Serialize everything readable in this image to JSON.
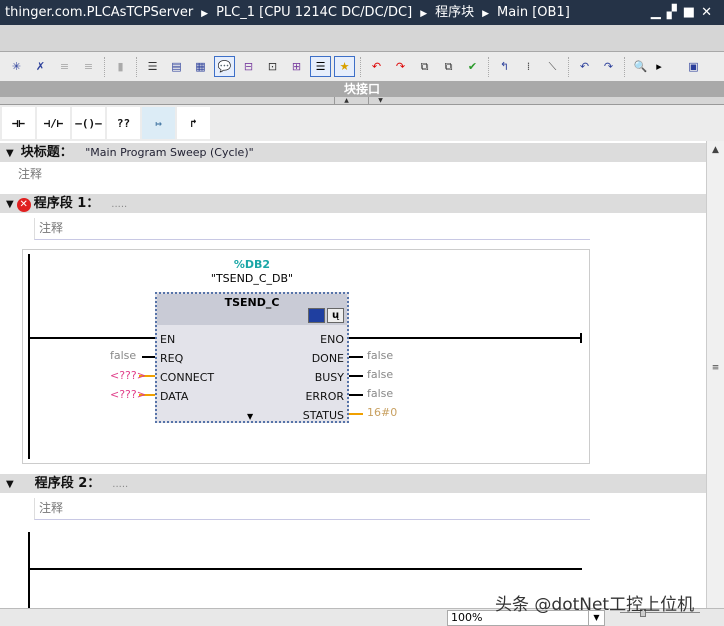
{
  "breadcrumb": [
    "thinger.com.PLCAsTCPServer",
    "PLC_1 [CPU 1214C DC/DC/DC]",
    "程序块",
    "Main [OB1]"
  ],
  "window_controls": {
    "minimize": "▁",
    "restore": "▞",
    "maximize": "■",
    "close": "✕"
  },
  "toolbar": {
    "icons": [
      "insert-network",
      "delete-network",
      "insert-row",
      "add-row",
      "disabled-io",
      "align-left",
      "networks-open",
      "networks-close",
      "comments",
      "absolute-address",
      "symbolic-info",
      "tag-info",
      "display-favorites",
      "favorites",
      "goto-error-prev",
      "goto-error-next",
      "monitor-compare",
      "download-compare",
      "check-ok",
      "goto-prev",
      "goto-next",
      "goto-last",
      "jump-back",
      "jump-forward",
      "watch",
      "block-interface"
    ]
  },
  "interface_label": "块接口",
  "instructions": [
    "⊣⊢",
    "⊣/⊢",
    "–()–",
    "??",
    "↦",
    "↱"
  ],
  "block_title": {
    "label": "块标题：",
    "value": "\"Main Program Sweep (Cycle)\"",
    "comment": "注释"
  },
  "networks": [
    {
      "label": "程序段 1：",
      "title": ".....",
      "comment": "注释",
      "has_error": true
    },
    {
      "label": "程序段 2：",
      "title": ".....",
      "comment": "注释",
      "has_error": false
    }
  ],
  "fb": {
    "db_address": "%DB2",
    "db_name": "\"TSEND_C_DB\"",
    "name": "TSEND_C",
    "inputs": [
      {
        "name": "EN",
        "value": ""
      },
      {
        "name": "REQ",
        "value": "false"
      },
      {
        "name": "CONNECT",
        "value": "<???>"
      },
      {
        "name": "DATA",
        "value": "<???>"
      }
    ],
    "outputs": [
      {
        "name": "ENO",
        "value": ""
      },
      {
        "name": "DONE",
        "value": "false"
      },
      {
        "name": "BUSY",
        "value": "false"
      },
      {
        "name": "ERROR",
        "value": "false"
      },
      {
        "name": "STATUS",
        "value": "16#0"
      }
    ]
  },
  "zoom": {
    "value": "100%"
  },
  "watermark": "头条 @dotNet工控上位机"
}
